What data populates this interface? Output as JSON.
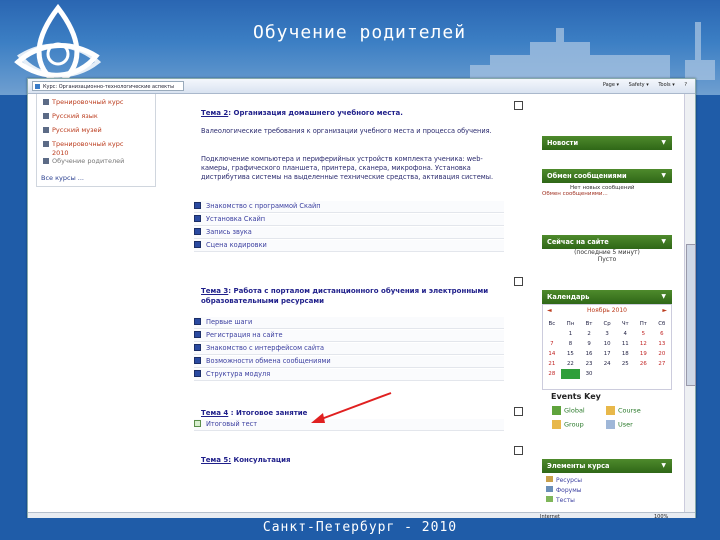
{
  "banner": {
    "title": "Обучение родителей"
  },
  "footer": {
    "text": "Санкт-Петербург - 2010"
  },
  "browser": {
    "tab_title": "Курс: Организационно-технологические аспекты",
    "tools": [
      "Page ▾",
      "Safety ▾",
      "Tools ▾",
      "?"
    ],
    "status_zone": "Internet",
    "zoom": "100%"
  },
  "courses": {
    "items": [
      "Тренировочный курс",
      "Русский язык",
      "Русский музей",
      "Тренировочный курс",
      "2010",
      "Обучение родителей"
    ],
    "all_courses": "Все курсы ..."
  },
  "topics": [
    {
      "prefix": "Тема 2",
      "title": ": Организация домашнего учебного места.",
      "paragraphs": [
        "Валеологические требования к организации учебного места и процесса обучения.",
        "Подключение компьютера и периферийных устройств комплекта ученика: web-камеры, графического планшета, принтера, сканера, микрофона. Установка дистрибутива системы на выделенные технические средства, активация системы."
      ],
      "resources": [
        "Знакомство с программой Скайп",
        "Установка Скайп",
        "Запись звука",
        "Сцена кодировки"
      ]
    },
    {
      "prefix": "Тема 3",
      "title": ": Работа с порталом дистанционного обучения и электронными образовательными ресурсами",
      "resources": [
        "Первые шаги",
        "Регистрация на сайте",
        "Знакомство с интерфейсом сайта",
        "Возможности обмена сообщениями",
        "Структура модуля"
      ]
    },
    {
      "prefix": "Тема 4",
      "title": " : Итоговое занятие",
      "resources": [
        "Итоговый тест"
      ]
    },
    {
      "prefix": "Тема 5:",
      "title": " Консультация",
      "resources": []
    }
  ],
  "blocks": {
    "news": {
      "title": "Новости"
    },
    "messages": {
      "title": "Обмен сообщениями",
      "line1": "Нет новых сообщений",
      "line2": "Обмен сообщениями..."
    },
    "online": {
      "title": "Сейчас на сайте",
      "line1": "(последние 5 минут)",
      "line2": "Пусто"
    },
    "calendar": {
      "title": "Календарь",
      "month": "Ноябрь 2010",
      "prev": "◄",
      "next": "►",
      "weekdays": [
        "Вс",
        "Пн",
        "Вт",
        "Ср",
        "Чт",
        "Пт",
        "Сб"
      ],
      "weeks": [
        [
          "",
          "1",
          "2",
          "3",
          "4",
          "5",
          "6"
        ],
        [
          "7",
          "8",
          "9",
          "10",
          "11",
          "12",
          "13"
        ],
        [
          "14",
          "15",
          "16",
          "17",
          "18",
          "19",
          "20"
        ],
        [
          "21",
          "22",
          "23",
          "24",
          "25",
          "26",
          "27"
        ],
        [
          "28",
          "29",
          "30",
          "",
          "",
          "",
          ""
        ]
      ],
      "today": "29"
    },
    "events_key": {
      "title": "Events Key",
      "global": "Global",
      "course": "Course",
      "group": "Group",
      "user": "User"
    },
    "elements": {
      "title": "Элементы курса",
      "items": [
        "Ресурсы",
        "Форумы",
        "Тесты"
      ]
    }
  },
  "colors": {
    "accent_green": "#3f7a22",
    "link_blue": "#1f1f8a",
    "banner_blue": "#1f5ca8"
  }
}
